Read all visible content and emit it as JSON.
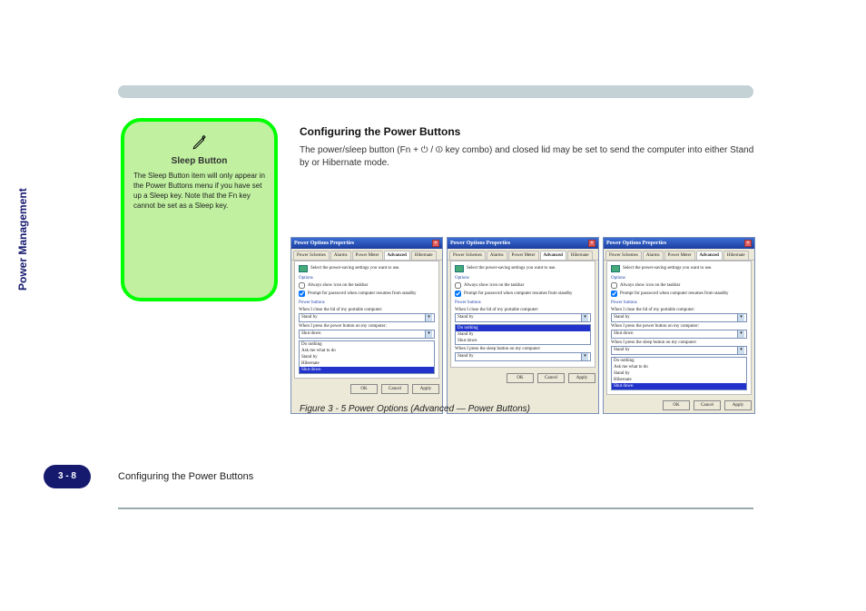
{
  "banner_title": "Power Management",
  "callout": {
    "heading": "Sleep Button",
    "body": "The Sleep Button item will only appear in the Power Buttons menu if you have set up a Sleep key. Note that the Fn key cannot be set as a Sleep key."
  },
  "main": {
    "heading": "Configuring the Power Buttons",
    "para": "The power/sleep button (Fn + ⏻ / ⏼ key combo) and closed lid may be set to send the computer into either Stand by or Hibernate mode."
  },
  "dialog": {
    "title": "Power Options Properties",
    "tabs": [
      "Power Schemes",
      "Alarms",
      "Power Meter",
      "Advanced",
      "Hibernate"
    ],
    "desc": "Select the power-saving settings you want to use.",
    "opt_group": "Options",
    "chk1": "Always show icon on the taskbar",
    "chk2": "Prompt for password when computer resumes from standby",
    "pb_group": "Power buttons",
    "lid_label": "When I close the lid of my portable computer:",
    "lid_val": "Stand by",
    "pwr_label": "When I press the power button on my computer:",
    "pwr_val": "Shut down",
    "slp_label": "When I press the sleep button on my computer:",
    "slp_val": "Stand by",
    "ok": "OK",
    "cancel": "Cancel",
    "apply": "Apply",
    "list_options": [
      "Do nothing",
      "Ask me what to do",
      "Stand by",
      "Hibernate",
      "Shut down"
    ]
  },
  "caption": "Figure 3 - 5  Power Options (Advanced — Power Buttons)",
  "page_badge": "3 - 8",
  "chapter": "Configuring the Power Buttons",
  "side_label": "Power Management"
}
